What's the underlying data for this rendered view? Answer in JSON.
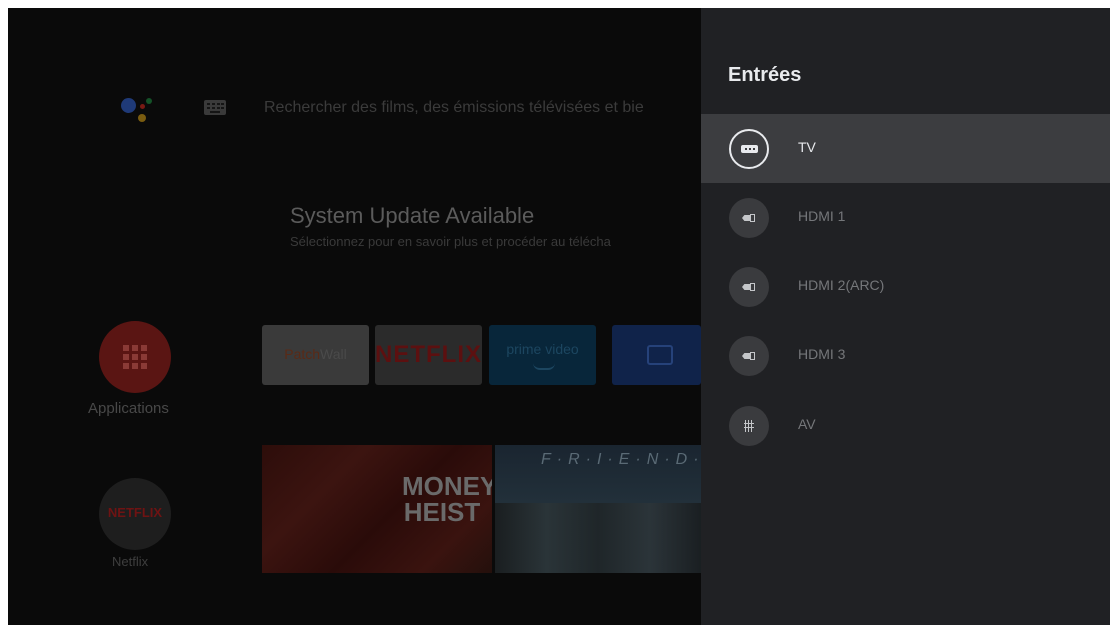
{
  "home": {
    "search_placeholder": "Rechercher des films, des émissions télévisées et bie",
    "update_title": "System Update Available",
    "update_subtitle": "Sélectionnez pour en savoir plus et procéder au télécha",
    "left_items": [
      {
        "label": "Applications"
      },
      {
        "label": "Netflix",
        "icon_text": "NETFLIX"
      }
    ],
    "app_tiles": [
      {
        "text_a": "Patch",
        "text_b": "Wall"
      },
      {
        "text": "NETFLIX"
      },
      {
        "text": "prime video"
      },
      {
        "icon": "tv-icon"
      }
    ],
    "posters": [
      {
        "text": "MONEY HEIST"
      },
      {
        "text": "F·R·I·E·N·D·S"
      }
    ]
  },
  "panel": {
    "title": "Entrées",
    "inputs": [
      {
        "label": "TV",
        "icon": "tv-input-icon",
        "selected": true
      },
      {
        "label": "HDMI 1",
        "icon": "hdmi-icon",
        "selected": false
      },
      {
        "label": "HDMI 2(ARC)",
        "icon": "hdmi-icon",
        "selected": false
      },
      {
        "label": "HDMI 3",
        "icon": "hdmi-icon",
        "selected": false
      },
      {
        "label": "AV",
        "icon": "av-icon",
        "selected": false
      }
    ]
  },
  "colors": {
    "panel_bg": "#202124",
    "selected_row": "#3c3d40",
    "text_primary": "#e8eaed",
    "text_secondary": "#75777a"
  }
}
